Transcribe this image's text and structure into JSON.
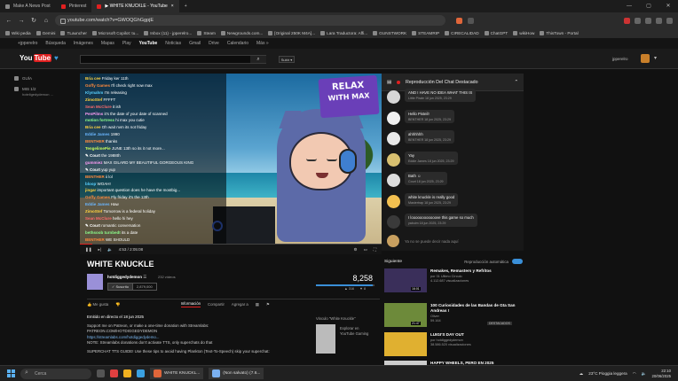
{
  "window_tabs": [
    {
      "label": "Make A News Post",
      "color": "#8a8a8a"
    },
    {
      "label": "Pinterest",
      "color": "#e02020"
    },
    {
      "label": "▶ WHITE KNUCKLE - YouTube",
      "color": "#e02020"
    }
  ],
  "address": {
    "url": "youtube.com/watch?v=GWOQGhGgpjE"
  },
  "bookmarks": [
    "Wiki pedia",
    "Gemini",
    "TLauncher",
    "Microsoft Copilot: tu...",
    "Inbox (11) - jpperelro...",
    "Steam",
    "Newgrounds.com...",
    "[Original 250K M4A]...",
    "Lara Traductora: Affi...",
    "GUNSTWORK",
    "STEAMRIP",
    "CIRECALIDAD",
    "ChatGPT",
    "wikiHow",
    "ThisTown - Portal"
  ],
  "google_links": [
    "+jpperelro",
    "Búsqueda",
    "Imágenes",
    "Mapas",
    "Play",
    "YouTube",
    "Noticias",
    "Gmail",
    "Drive",
    "Calendario",
    "Más »"
  ],
  "youtube_header": {
    "logo_you": "You",
    "logo_tube": "Tube",
    "upload_label": "Subir ▾",
    "username": "jpperelro"
  },
  "guide": {
    "items": [
      "GUÍA",
      "MIS 1/2"
    ],
    "sub": "hoteligedydemon ..."
  },
  "video": {
    "overlay_title_1": "RELAX",
    "overlay_title_2": "WITH MAX",
    "time": "4:53 / 2:05:08",
    "progress": 0.04,
    "overlay_chat": [
      {
        "user": "Bria cee",
        "msg": "Friday ker 11th",
        "color": "#ffd23f"
      },
      {
        "user": "Goffy Games",
        "msg": "I'll check right now max",
        "color": "#ff8a3d"
      },
      {
        "user": "Klymahm",
        "msg": "I'm releasing",
        "color": "#5ad1ff"
      },
      {
        "user": "ZimoStef",
        "msg": "FFFFT",
        "color": "#ffd23f"
      },
      {
        "user": "Sean McClure",
        "msg": "it ish",
        "color": "#ff6b6b"
      },
      {
        "user": "PenPilms",
        "msg": "it's the date of your date of scanned",
        "color": "#ff9df5"
      },
      {
        "user": "motion fortress",
        "msg": "hi max you cutie",
        "color": "#8cff8c"
      },
      {
        "user": "Bria cee",
        "msg": "Oh wait nvm its not friday",
        "color": "#ffd23f"
      },
      {
        "user": "Eddie James",
        "msg": "1990",
        "color": "#6bb7ff"
      },
      {
        "user": "BENTHER",
        "msg": "thanks",
        "color": "#ff8a3d"
      },
      {
        "user": "TengelimePie",
        "msg": "JUNE 13th so its it not more...",
        "color": "#c8ff5a"
      },
      {
        "user": "✎ Court",
        "msg": "the 1988th",
        "color": "#ffffff"
      },
      {
        "user": "gummiez",
        "msg": "MAX GILARD MY BEAUTIFUL GORGEOUS KING",
        "color": "#ff9df5"
      },
      {
        "user": "✎ Court",
        "msg": "yup yup",
        "color": "#ffffff"
      },
      {
        "user": "BENTHER",
        "msg": "ii lol",
        "color": "#ff8a3d"
      },
      {
        "user": "bloop",
        "msg": "WOAH!",
        "color": "#5ad1ff"
      },
      {
        "user": "jingar",
        "msg": "important question does he have the mostbig...",
        "color": "#ffd23f"
      },
      {
        "user": "Goffy Games",
        "msg": "Fly friday it's the 13th",
        "color": "#ff8a3d"
      },
      {
        "user": "Eddie James",
        "msg": "Haw",
        "color": "#6bb7ff"
      },
      {
        "user": "ZimoStef",
        "msg": "Tomorrow is a federal holiday",
        "color": "#ffd23f"
      },
      {
        "user": "Sean McClure",
        "msg": "hello hi hey",
        "color": "#ff6b6b"
      },
      {
        "user": "✎ Court",
        "msg": "romantic conversation",
        "color": "#ffffff"
      },
      {
        "user": "bethsoob turnbedt",
        "msg": "its a date",
        "color": "#8cff8c"
      },
      {
        "user": "BENTHER",
        "msg": "WE SHOULD",
        "color": "#ff8a3d"
      }
    ]
  },
  "video_info": {
    "title": "WHITE KNUCKLE",
    "channel": "hotdiggedydemon",
    "channel_badge": "☰",
    "video_count": "232 vídeos",
    "subscribe_label": "Suscrito",
    "sub_count": "2,879,000",
    "views": "8,258",
    "like_ratio": 0.97,
    "likes": "316",
    "dislikes": "8"
  },
  "actions": [
    "Me gusta",
    "Información",
    "Compartir",
    "Agregar a",
    "",
    ""
  ],
  "description": {
    "streamed": "Emitido en directo el 18 jun 2025",
    "lines": [
      "Support me on Patreon, or make a one-time donation with Streamlabs:",
      "PATREON.COM/HOTDIGGEDYDEMON",
      "https://streamlabs.com/hotdiggedydemo...",
      "NOTE: Streamlabs donations don't activate TTS, only superchats do that",
      "SUPERCHAT TTS GUIDE! Use these tips to avoid having Plankton (Text-To-Speech) skip your superchat:"
    ]
  },
  "song": {
    "heading": "Vinculo \"White Knuckle\"",
    "line1": "Explorar en",
    "line2": "YouTube Gaming"
  },
  "chat": {
    "header": "Reproducción Del Chat Destacado",
    "messages": [
      {
        "text": "AND I HAVE NO IDEA WHAT THIS IS",
        "meta": "Little Pirate   18 jun 2025, 23:29",
        "avatar": "#d6d6d6"
      },
      {
        "text": "Hello Pisteil!",
        "meta": "BENTHER   18 jun 2025, 23:29",
        "avatar": "#f0f0f0"
      },
      {
        "text": "ahhhhhh",
        "meta": "BENTHER   18 jun 2025, 23:29",
        "avatar": "#e8e8e8"
      },
      {
        "text": "Yay",
        "meta": "Eddie James   18 jun 2025, 23:29",
        "avatar": "#d8c070"
      },
      {
        "text": "Bath ☺",
        "meta": "Court   18 jun 2025, 23:29",
        "avatar": "#ddd"
      },
      {
        "text": "white knuckle is really good",
        "meta": "Mastertrap   18 jun 2025, 23:29",
        "avatar": "#f2c050"
      },
      {
        "text": "I loooooooooooove this game so much",
        "meta": "yabuim   18 jun 2025, 23:29",
        "avatar": "#3a3a3a"
      }
    ],
    "input_placeholder": "Ya no se puede decir nada aquí"
  },
  "upnext": {
    "heading": "Siguiente",
    "autoplay": "Reproducción automática",
    "items": [
      {
        "title": "Remakes, Remasters y Refritos",
        "channel": "por 31 Ultimo Círculo",
        "views": "4.112.687 visualizaciones",
        "duration": "16:01",
        "color": "#3a2f5a",
        "badge": ""
      },
      {
        "title": "100 Curiosidades de las Bandas de Gta San Andreas !",
        "channel": "Oliver",
        "views": "59.164",
        "duration": "21:47",
        "color": "#6d8a3a",
        "badge": "DESTACADOS"
      },
      {
        "title": "LUIGI'S DAY OUT",
        "channel": "por hotdiggedydemon",
        "views": "38.586.520 visualizaciones",
        "duration": "",
        "color": "#e0b030",
        "badge": ""
      },
      {
        "title": "HAPPY WHEELS, PERO EN 2025",
        "channel": "",
        "views": "",
        "duration": "",
        "color": "#cccccc",
        "badge": ""
      }
    ]
  },
  "taskbar": {
    "search_label": "Cerca",
    "tabs": [
      "WHITE KNUCKL...",
      "(Non salvato) (7.6..."
    ],
    "weather": "23°C  Pioggia leggera",
    "time": "22:10",
    "date": "20/06/2025"
  }
}
